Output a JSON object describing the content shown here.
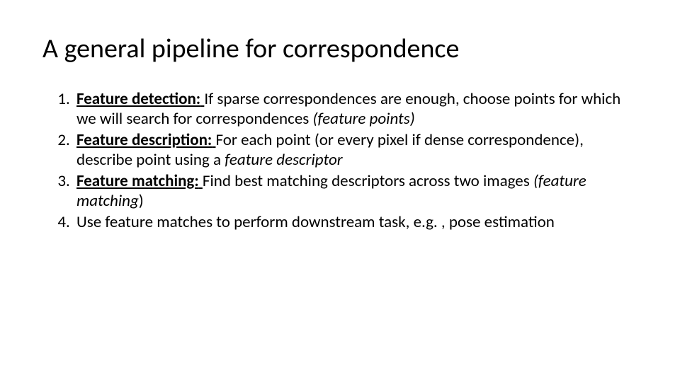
{
  "title": "A general pipeline for correspondence",
  "items": [
    {
      "lead": "Feature detection:",
      "body_a": "If sparse correspondences are enough, choose points for which we will search for correspondences ",
      "ital_a": "(feature points)",
      "body_b": "",
      "ital_b": ""
    },
    {
      "lead": "Feature description:",
      "body_a": "For each point (or every pixel if dense correspondence), describe point using a ",
      "ital_a": "feature descriptor",
      "body_b": "",
      "ital_b": ""
    },
    {
      "lead": "Feature matching:",
      "body_a": "Find best matching descriptors across two images ",
      "ital_a": "(feature matching",
      "body_b": ")",
      "ital_b": ""
    },
    {
      "lead": "",
      "body_a": "Use feature matches to perform downstream task, e.g. , pose estimation",
      "ital_a": "",
      "body_b": "",
      "ital_b": ""
    }
  ]
}
